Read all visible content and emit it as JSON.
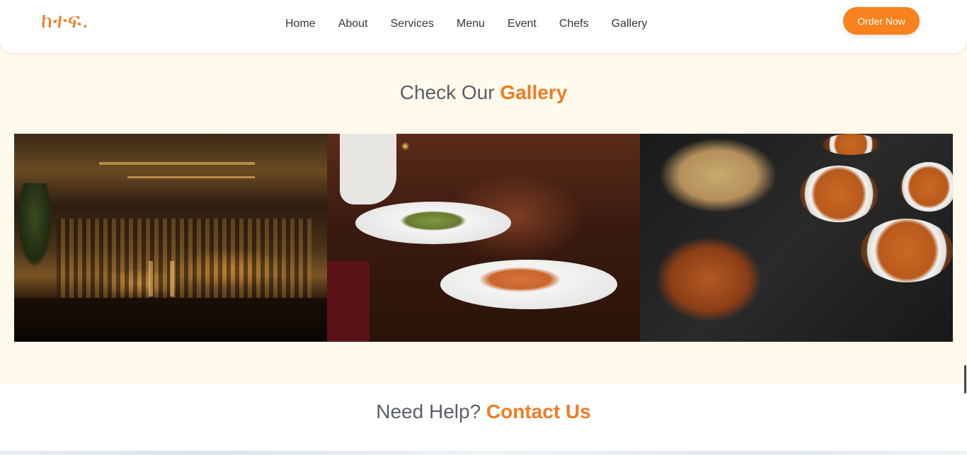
{
  "header": {
    "logo": "ከተፍ.",
    "nav": [
      "Home",
      "About",
      "Services",
      "Menu",
      "Event",
      "Chefs",
      "Gallery"
    ],
    "order_button": "Order Now"
  },
  "gallery": {
    "title_prefix": "Check Our ",
    "title_accent": "Gallery"
  },
  "contact": {
    "title_prefix": "Need Help? ",
    "title_accent": "Contact Us"
  },
  "colors": {
    "accent": "#f07b25",
    "button": "#f7821e",
    "section_bg": "#fffaeb",
    "heading_gray": "#5b6068"
  }
}
